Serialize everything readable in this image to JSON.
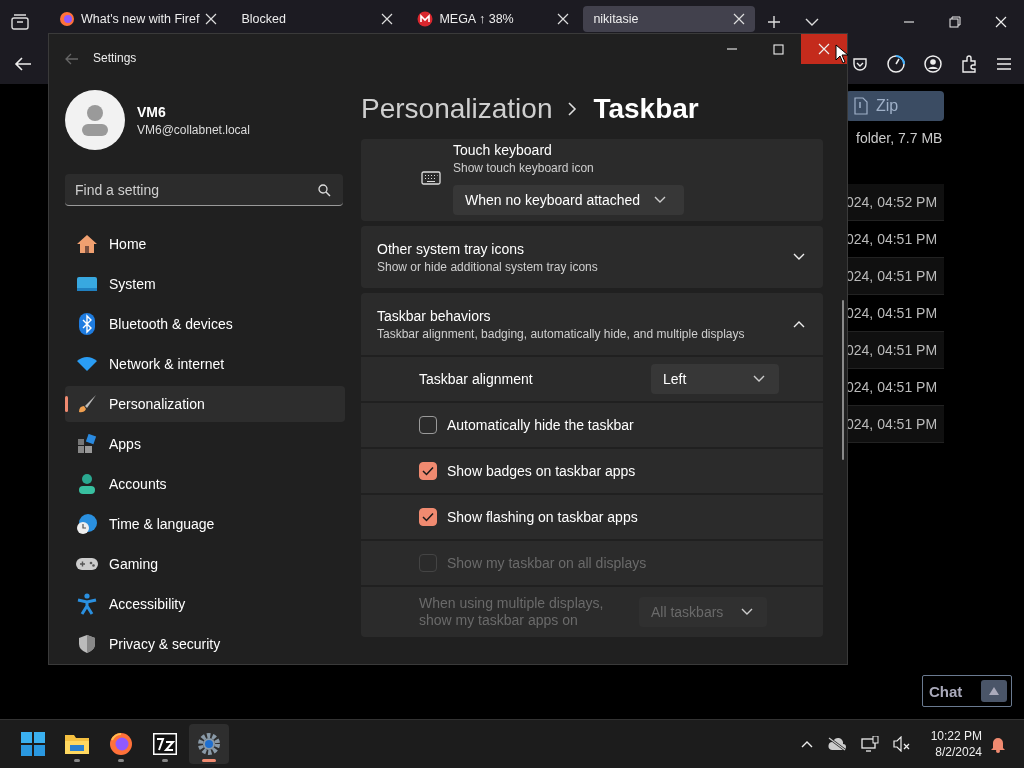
{
  "browser": {
    "tabs": [
      {
        "label": "What's new with Firef",
        "selected": false
      },
      {
        "label": "Blocked",
        "selected": false
      },
      {
        "label": "MEGA ↑ 38%",
        "selected": false
      },
      {
        "label": "nikitasie",
        "selected": true
      }
    ],
    "page": {
      "zip_button": "Zip",
      "file_summary": "folder, 7.7 MB",
      "rows": [
        "024, 04:52 PM",
        "024, 04:51 PM",
        "024, 04:51 PM",
        "024, 04:51 PM",
        "024, 04:51 PM",
        "024, 04:51 PM",
        "024, 04:51 PM"
      ]
    },
    "chat": {
      "label": "Chat"
    }
  },
  "settings": {
    "title": "Settings",
    "close_hovered": true,
    "profile": {
      "name": "VM6",
      "email": "VM6@collabnet.local"
    },
    "search": {
      "placeholder": "Find a setting"
    },
    "nav": [
      {
        "label": "Home",
        "selected": false
      },
      {
        "label": "System",
        "selected": false
      },
      {
        "label": "Bluetooth & devices",
        "selected": false
      },
      {
        "label": "Network & internet",
        "selected": false
      },
      {
        "label": "Personalization",
        "selected": true
      },
      {
        "label": "Apps",
        "selected": false
      },
      {
        "label": "Accounts",
        "selected": false
      },
      {
        "label": "Time & language",
        "selected": false
      },
      {
        "label": "Gaming",
        "selected": false
      },
      {
        "label": "Accessibility",
        "selected": false
      },
      {
        "label": "Privacy & security",
        "selected": false
      }
    ],
    "breadcrumb": {
      "parent": "Personalization",
      "current": "Taskbar"
    },
    "touch_keyboard": {
      "title": "Touch keyboard",
      "subtitle": "Show touch keyboard icon",
      "value": "When no keyboard attached"
    },
    "sections": [
      {
        "title": "Other system tray icons",
        "subtitle": "Show or hide additional system tray icons",
        "expanded": false
      },
      {
        "title": "Taskbar behaviors",
        "subtitle": "Taskbar alignment, badging, automatically hide, and multiple displays",
        "expanded": true,
        "options": [
          {
            "kind": "dropdown",
            "label": "Taskbar alignment",
            "value": "Left",
            "disabled": false
          },
          {
            "kind": "checkbox",
            "label": "Automatically hide the taskbar",
            "checked": false,
            "disabled": false
          },
          {
            "kind": "checkbox",
            "label": "Show badges on taskbar apps",
            "checked": true,
            "disabled": false
          },
          {
            "kind": "checkbox",
            "label": "Show flashing on taskbar apps",
            "checked": true,
            "disabled": false
          },
          {
            "kind": "checkbox",
            "label": "Show my taskbar on all displays",
            "checked": false,
            "disabled": true
          },
          {
            "kind": "dropdown",
            "label": "When using multiple displays, show my taskbar apps on",
            "value": "All taskbars",
            "disabled": true
          }
        ]
      }
    ]
  },
  "taskbar": {
    "apps": [
      {
        "selected": false
      },
      {
        "selected": false
      },
      {
        "selected": false
      },
      {
        "selected": false
      },
      {
        "selected": true
      }
    ],
    "clock": {
      "time": "10:22 PM",
      "date": "8/2/2024"
    }
  }
}
